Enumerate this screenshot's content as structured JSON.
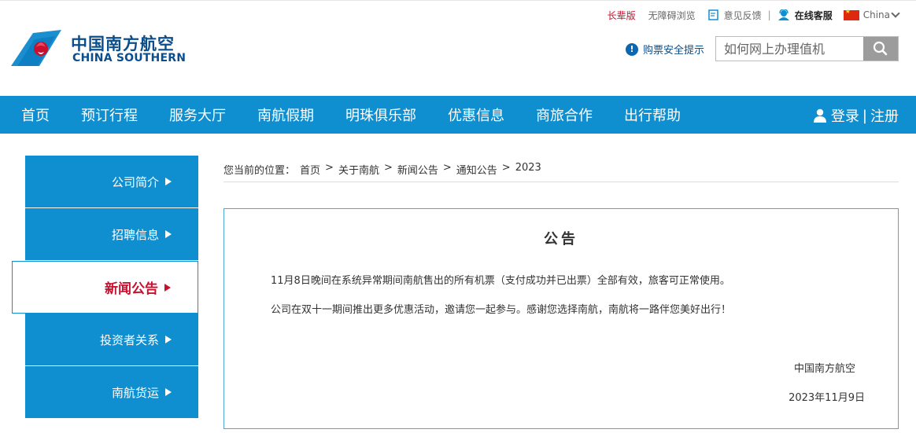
{
  "header": {
    "logo_cn": "中国南方航空",
    "logo_en": "CHINA SOUTHERN",
    "toplinks": {
      "elder": "长辈版",
      "accessible": "无障碍浏览",
      "feedback": "意见反馈",
      "separator": "|",
      "service": "在线客服",
      "region": "China"
    },
    "safety_tip": "购票安全提示",
    "search": {
      "placeholder": "如何网上办理值机"
    }
  },
  "nav": {
    "items": [
      "首页",
      "预订行程",
      "服务大厅",
      "南航假期",
      "明珠俱乐部",
      "优惠信息",
      "商旅合作",
      "出行帮助"
    ],
    "login": "登录",
    "divider": "|",
    "register": "注册"
  },
  "sidebar": {
    "items": [
      {
        "label": "公司简介",
        "active": false
      },
      {
        "label": "招聘信息",
        "active": false
      },
      {
        "label": "新闻公告",
        "active": true
      },
      {
        "label": "投资者关系",
        "active": false
      },
      {
        "label": "南航货运",
        "active": false
      }
    ]
  },
  "breadcrumb": {
    "prefix": "您当前的位置：",
    "items": [
      "首页",
      "关于南航",
      "新闻公告",
      "通知公告",
      "2023"
    ],
    "separator": ">"
  },
  "notice": {
    "title": "公告",
    "paragraphs": [
      "11月8日晚间在系统异常期间南航售出的所有机票（支付成功并已出票）全部有效，旅客可正常使用。",
      "公司在双十一期间推出更多优惠活动，邀请您一起参与。感谢您选择南航，南航将一路伴您美好出行！"
    ],
    "signature": "中国南方航空",
    "date": "2023年11月9日"
  },
  "colors": {
    "brand_blue": "#0f8fd0",
    "logo_navy": "#0a4e8c",
    "accent_red": "#c8102e"
  }
}
